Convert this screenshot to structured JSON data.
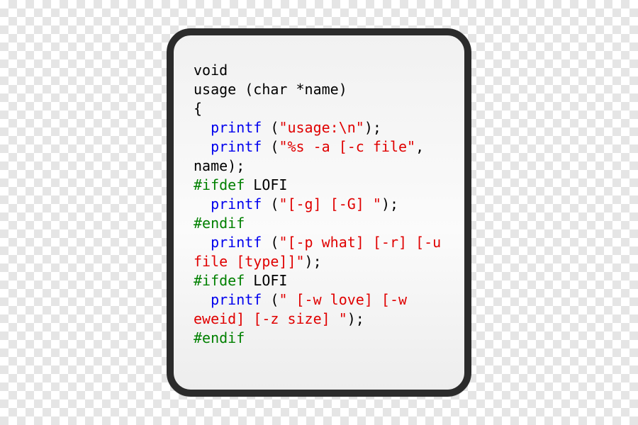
{
  "code": {
    "tokens": [
      {
        "cls": "",
        "text": "void\n"
      },
      {
        "cls": "",
        "text": "usage (char *name)\n"
      },
      {
        "cls": "",
        "text": "{\n"
      },
      {
        "cls": "",
        "text": "  "
      },
      {
        "cls": "kw",
        "text": "printf"
      },
      {
        "cls": "",
        "text": " ("
      },
      {
        "cls": "str",
        "text": "\"usage:\\n\""
      },
      {
        "cls": "",
        "text": ");\n"
      },
      {
        "cls": "",
        "text": "  "
      },
      {
        "cls": "kw",
        "text": "printf"
      },
      {
        "cls": "",
        "text": " ("
      },
      {
        "cls": "str",
        "text": "\"%s -a [-c file\""
      },
      {
        "cls": "",
        "text": ", name);\n"
      },
      {
        "cls": "pp",
        "text": "#ifdef"
      },
      {
        "cls": "",
        "text": " LOFI\n"
      },
      {
        "cls": "",
        "text": "  "
      },
      {
        "cls": "kw",
        "text": "printf"
      },
      {
        "cls": "",
        "text": " ("
      },
      {
        "cls": "str",
        "text": "\"[-g] [-G] \""
      },
      {
        "cls": "",
        "text": ");\n"
      },
      {
        "cls": "pp",
        "text": "#endif"
      },
      {
        "cls": "",
        "text": "\n"
      },
      {
        "cls": "",
        "text": "  "
      },
      {
        "cls": "kw",
        "text": "printf"
      },
      {
        "cls": "",
        "text": " ("
      },
      {
        "cls": "str",
        "text": "\"[-p what] [-r] [-u file [type]]\""
      },
      {
        "cls": "",
        "text": ");\n"
      },
      {
        "cls": "pp",
        "text": "#ifdef"
      },
      {
        "cls": "",
        "text": " LOFI\n"
      },
      {
        "cls": "",
        "text": "  "
      },
      {
        "cls": "kw",
        "text": "printf"
      },
      {
        "cls": "",
        "text": " ("
      },
      {
        "cls": "str",
        "text": "\" [-w love] [-w eweid] [-z size] \""
      },
      {
        "cls": "",
        "text": ");\n"
      },
      {
        "cls": "pp",
        "text": "#endif"
      }
    ]
  }
}
